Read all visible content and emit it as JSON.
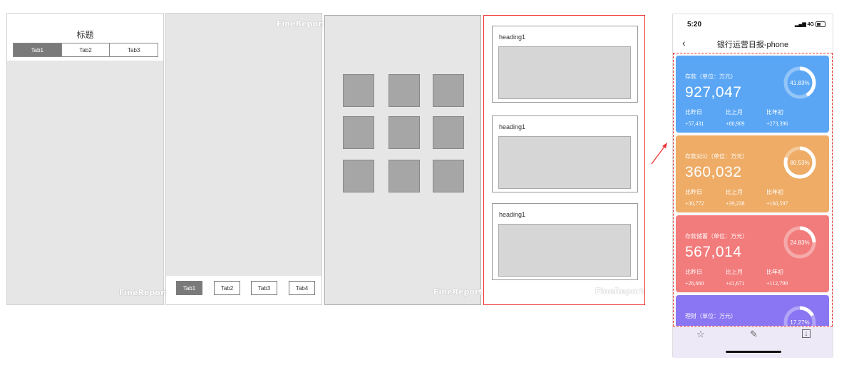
{
  "panel1": {
    "title": "标题",
    "tabs": [
      "Tab1",
      "Tab2",
      "Tab3"
    ],
    "watermark": "FineReport"
  },
  "panel2": {
    "watermark": "FineReport",
    "tabs": [
      "Tab1",
      "Tab2",
      "Tab3",
      "Tab4"
    ]
  },
  "panel3": {
    "watermark": "FineReport"
  },
  "panel4": {
    "headings": [
      "heading1",
      "heading1",
      "heading1"
    ],
    "watermark": "FineReport"
  },
  "phone": {
    "time": "5:20",
    "signal": "4G",
    "title": "银行运营日报-phone",
    "back_icon": "chevron-left-icon",
    "cards": [
      {
        "label": "存款（单位：万元）",
        "value": "927,047",
        "percent": "41.83%",
        "fraction": 0.4183,
        "color": "#5aa6f5",
        "compare_labels": [
          "比昨日",
          "比上月",
          "比年初"
        ],
        "compare_values": [
          "+57,431",
          "+80,909",
          "+273,396"
        ]
      },
      {
        "label": "存款对公（单位：万元）",
        "value": "360,032",
        "percent": "80.53%",
        "fraction": 0.8053,
        "color": "#eeac66",
        "compare_labels": [
          "比昨日",
          "比上月",
          "比年初"
        ],
        "compare_values": [
          "+30,772",
          "+39,238",
          "+160,597"
        ]
      },
      {
        "label": "存款储蓄（单位：万元）",
        "value": "567,014",
        "percent": "24.83%",
        "fraction": 0.2483,
        "color": "#f27b7b",
        "compare_labels": [
          "比昨日",
          "比上月",
          "比年初"
        ],
        "compare_values": [
          "+26,660",
          "+41,671",
          "+112,799"
        ]
      },
      {
        "label": "理财（单位：万元）",
        "value": "",
        "percent": "17.27%",
        "fraction": 0.1727,
        "color": "#8a76f2",
        "compare_labels": [
          "",
          "",
          ""
        ],
        "compare_values": [
          "",
          "",
          ""
        ]
      }
    ],
    "tabbar_icons": [
      "star-icon",
      "pencil-icon",
      "download-icon"
    ]
  }
}
